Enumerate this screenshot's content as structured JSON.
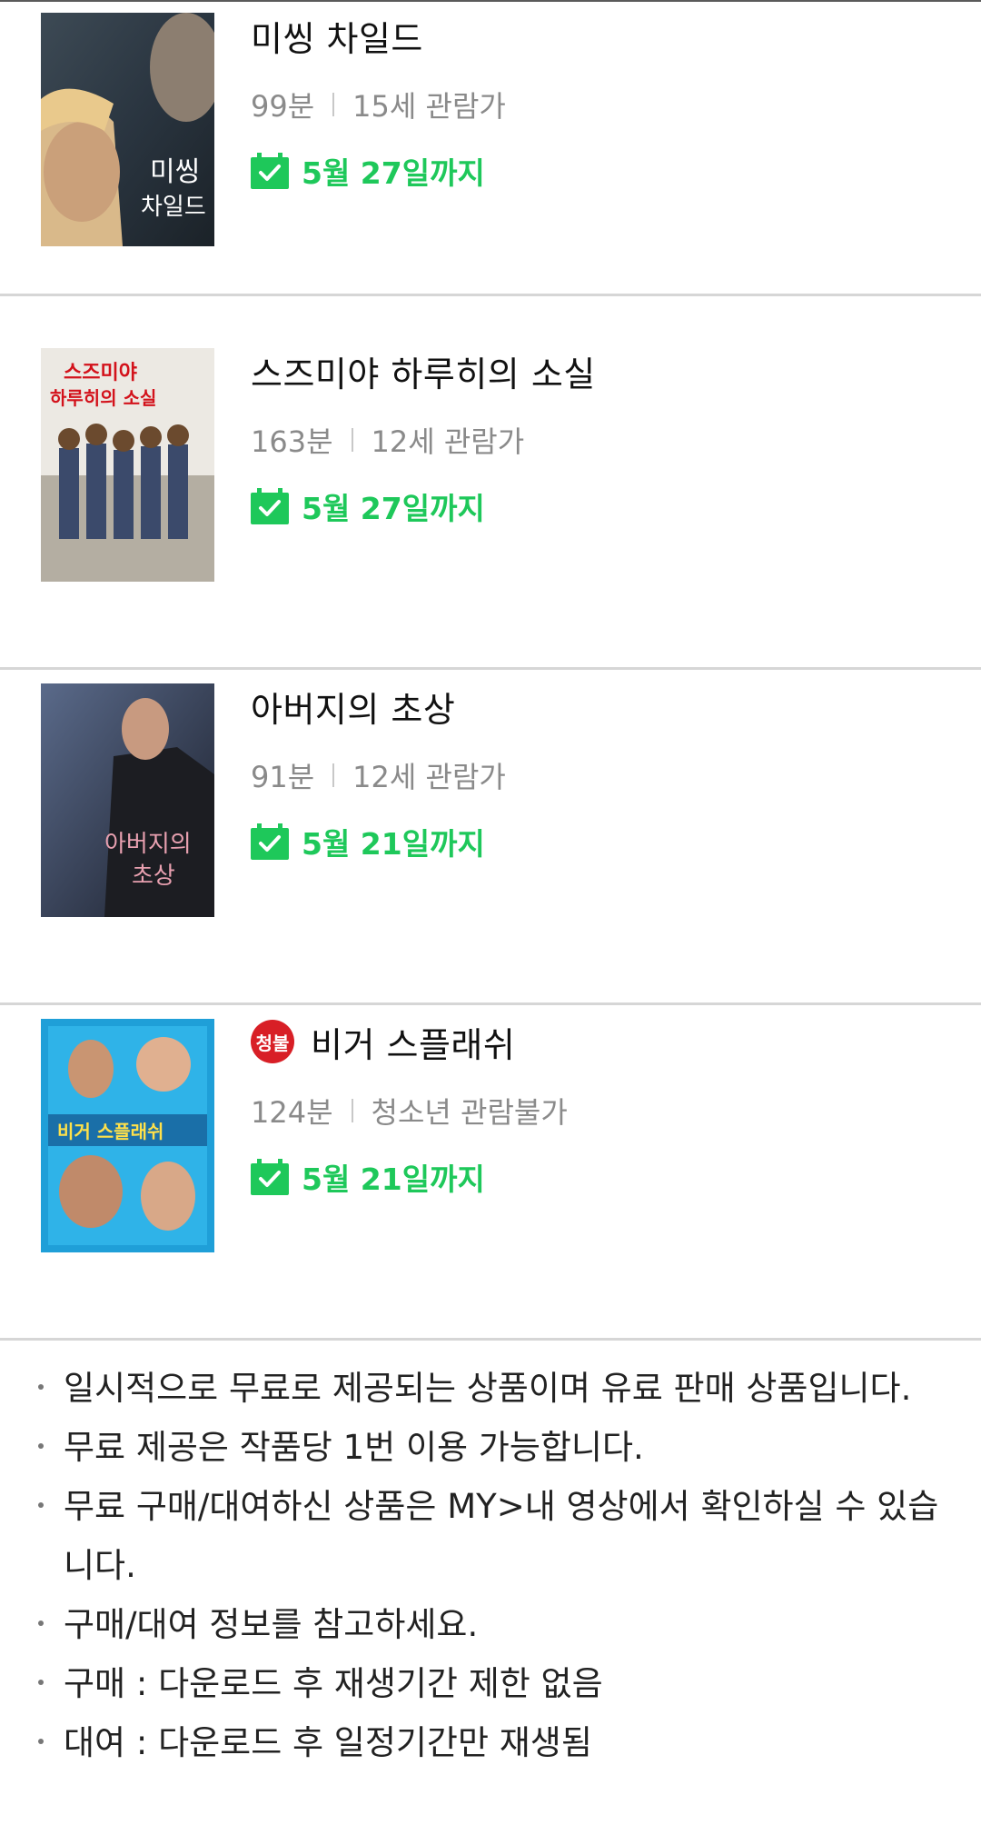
{
  "movies": [
    {
      "title": "미씽 차일드",
      "duration": "99분",
      "rating": "15세 관람가",
      "availability": "5월 27일까지",
      "poster_text": [
        "미씽",
        "차일드"
      ]
    },
    {
      "title": "스즈미야 하루히의 소실",
      "duration": "163분",
      "rating": "12세 관람가",
      "availability": "5월 27일까지",
      "poster_text": [
        "스즈미야",
        "하루히의 소실"
      ]
    },
    {
      "title": "아버지의 초상",
      "duration": "91분",
      "rating": "12세 관람가",
      "availability": "5월 21일까지",
      "poster_text": [
        "아버지의",
        "초상"
      ]
    },
    {
      "title": "비거 스플래쉬",
      "badge": "청불",
      "duration": "124분",
      "rating": "청소년 관람불가",
      "availability": "5월 21일까지",
      "poster_text": [
        "비거 스플래쉬"
      ]
    }
  ],
  "notes": [
    "일시적으로 무료로 제공되는 상품이며 유료 판매 상품입니다.",
    "무료 제공은 작품당 1번 이용 가능합니다.",
    "무료 구매/대여하신 상품은 MY>내 영상에서 확인하실 수 있습니다.",
    "구매/대여 정보를 참고하세요.",
    "구매 : 다운로드 후 재생기간 제한 없음",
    "대여 : 다운로드 후 일정기간만 재생됨"
  ],
  "colors": {
    "accent_green": "#1ec85a",
    "badge_red": "#d81f26",
    "meta_gray": "#8a8a8a",
    "divider": "#d6d6d6"
  }
}
